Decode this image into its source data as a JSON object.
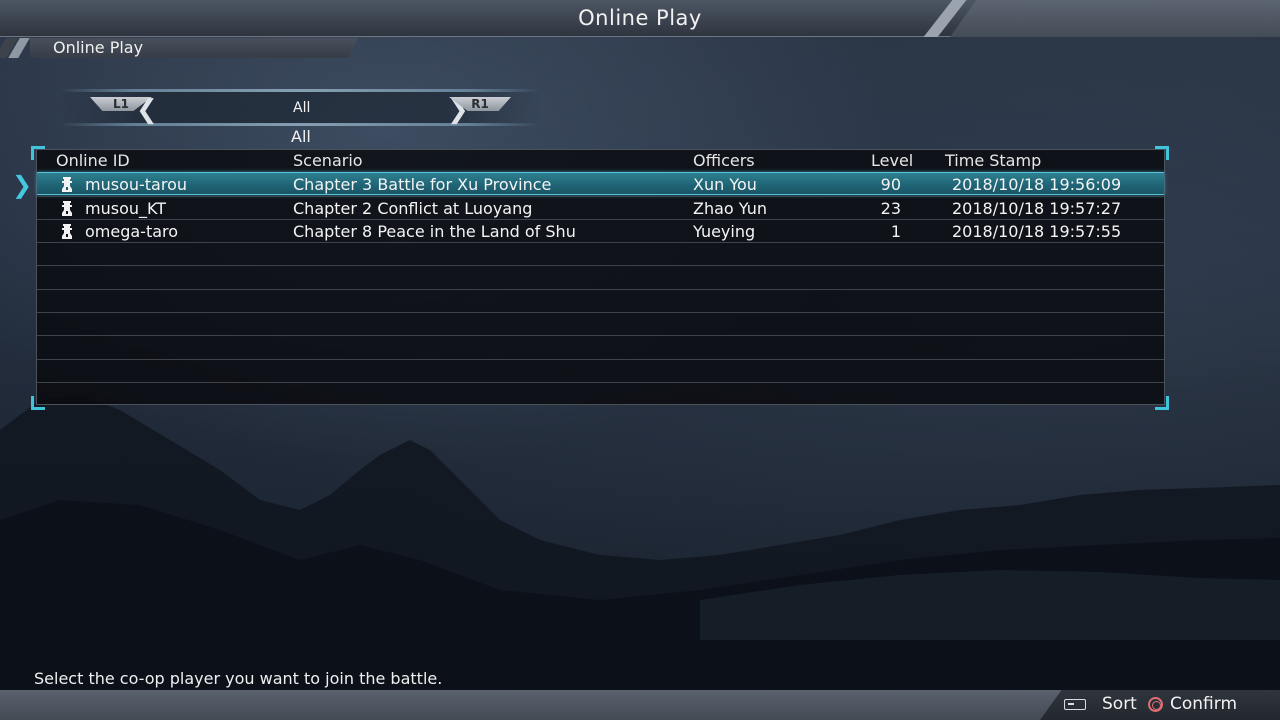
{
  "header": {
    "title": "Online Play"
  },
  "breadcrumb": {
    "label": "Online Play"
  },
  "filter": {
    "left_button": "L1",
    "right_button": "R1",
    "value": "All",
    "label": "All"
  },
  "table": {
    "columns": {
      "online_id": "Online ID",
      "scenario": "Scenario",
      "officers": "Officers",
      "level": "Level",
      "time_stamp": "Time Stamp"
    },
    "rows": [
      {
        "online_id": "musou-tarou",
        "scenario": "Chapter 3 Battle for Xu Province",
        "officers": "Xun You",
        "level": "90",
        "time_stamp": "2018/10/18 19:56:09",
        "selected": true
      },
      {
        "online_id": "musou_KT",
        "scenario": "Chapter 2 Conflict at Luoyang",
        "officers": "Zhao Yun",
        "level": "23",
        "time_stamp": "2018/10/18 19:57:27",
        "selected": false
      },
      {
        "online_id": "omega-taro",
        "scenario": "Chapter 8 Peace in the Land of Shu",
        "officers": "Yueying",
        "level": "1",
        "time_stamp": "2018/10/18 19:57:55",
        "selected": false
      }
    ]
  },
  "hint": "Select the co-op player you want to join the battle.",
  "footer": {
    "sort_label": "Sort",
    "confirm_label": "Confirm",
    "sort_icon": "touchpad-icon",
    "confirm_icon": "circle-button-icon"
  },
  "colors": {
    "accent": "#41c3dc",
    "selected_row": "#206677",
    "confirm_icon": "#e06d72"
  }
}
